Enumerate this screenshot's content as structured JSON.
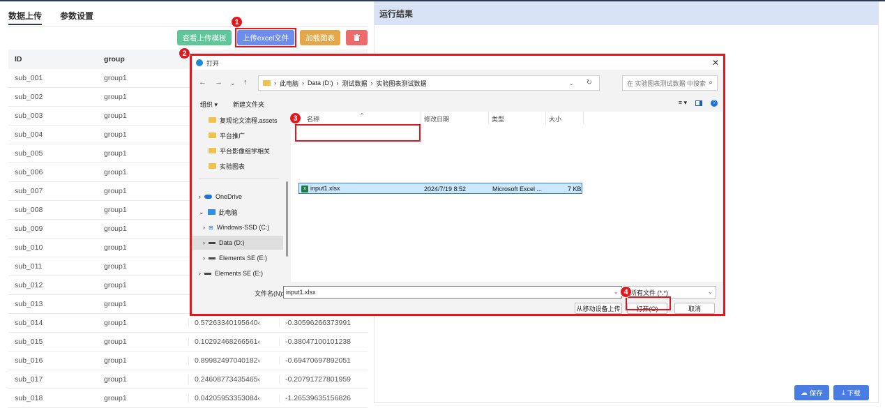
{
  "tabs": {
    "upload": "数据上传",
    "params": "参数设置"
  },
  "toolbar": {
    "template_label": "查看上传模板",
    "upload_label": "上传excel文件",
    "load_label": "加载图表",
    "delete_icon": "trash-icon"
  },
  "steps": [
    "1",
    "2",
    "3",
    "4"
  ],
  "table": {
    "columns": [
      "ID",
      "group"
    ],
    "rows": [
      {
        "id": "sub_001",
        "group": "group1",
        "v1": "",
        "v2": ""
      },
      {
        "id": "sub_002",
        "group": "group1",
        "v1": "",
        "v2": ""
      },
      {
        "id": "sub_003",
        "group": "group1",
        "v1": "",
        "v2": ""
      },
      {
        "id": "sub_004",
        "group": "group1",
        "v1": "",
        "v2": ""
      },
      {
        "id": "sub_005",
        "group": "group1",
        "v1": "",
        "v2": ""
      },
      {
        "id": "sub_006",
        "group": "group1",
        "v1": "",
        "v2": ""
      },
      {
        "id": "sub_007",
        "group": "group1",
        "v1": "",
        "v2": ""
      },
      {
        "id": "sub_008",
        "group": "group1",
        "v1": "",
        "v2": ""
      },
      {
        "id": "sub_009",
        "group": "group1",
        "v1": "",
        "v2": ""
      },
      {
        "id": "sub_010",
        "group": "group1",
        "v1": "",
        "v2": ""
      },
      {
        "id": "sub_011",
        "group": "group1",
        "v1": "",
        "v2": ""
      },
      {
        "id": "sub_012",
        "group": "group1",
        "v1": "",
        "v2": ""
      },
      {
        "id": "sub_013",
        "group": "group1",
        "v1": "",
        "v2": ""
      },
      {
        "id": "sub_014",
        "group": "group1",
        "v1": "0.57263340195640‹",
        "v2": "-0.30596266373991"
      },
      {
        "id": "sub_015",
        "group": "group1",
        "v1": "0.10292468266561‹",
        "v2": "-0.38047100101238"
      },
      {
        "id": "sub_016",
        "group": "group1",
        "v1": "0.89982497040182‹",
        "v2": "-0.69470697892051"
      },
      {
        "id": "sub_017",
        "group": "group1",
        "v1": "0.24608773435465‹",
        "v2": "-0.20791727801959"
      },
      {
        "id": "sub_018",
        "group": "group1",
        "v1": "0.04205953353084‹",
        "v2": "-1.26539635156826"
      }
    ]
  },
  "result": {
    "title": "运行结果",
    "save_label": "保存",
    "download_label": "下载"
  },
  "dialog": {
    "title": "打开",
    "breadcrumb": [
      "此电脑",
      "Data (D:)",
      "测试数据",
      "实验图表测试数据"
    ],
    "search_placeholder": "在 实验图表测试数据 中搜索",
    "organize": "组织 ▾",
    "new_folder": "新建文件夹",
    "nav": [
      {
        "label": "复现论文流程.assets",
        "type": "folder"
      },
      {
        "label": "平台推广",
        "type": "folder"
      },
      {
        "label": "平台影像组学相关",
        "type": "folder"
      },
      {
        "label": "实验图表",
        "type": "folder"
      },
      {
        "label": "OneDrive",
        "type": "cloud"
      },
      {
        "label": "此电脑",
        "type": "pc"
      },
      {
        "label": "Windows-SSD (C:)",
        "type": "drive"
      },
      {
        "label": "Data (D:)",
        "type": "drive"
      },
      {
        "label": "Elements SE (E:)",
        "type": "drive"
      },
      {
        "label": "Elements SE (E:)",
        "type": "drive"
      }
    ],
    "columns": {
      "name": "名称",
      "modified": "修改日期",
      "type": "类型",
      "size": "大小"
    },
    "file": {
      "name": "input1.xlsx",
      "modified": "2024/7/19 8:52",
      "type": "Microsoft Excel ...",
      "size": "7 KB"
    },
    "filename_label": "文件名(N):",
    "filename_value": "input1.xlsx",
    "filetype_value": "所有文件 (*.*)",
    "mobile_upload": "从移动设备上传",
    "open_label": "打开(O)",
    "cancel_label": "取消"
  },
  "colors": {
    "accent": "#6d8cf0",
    "highlight": "#e5161b",
    "header": "#d9e3f6"
  }
}
